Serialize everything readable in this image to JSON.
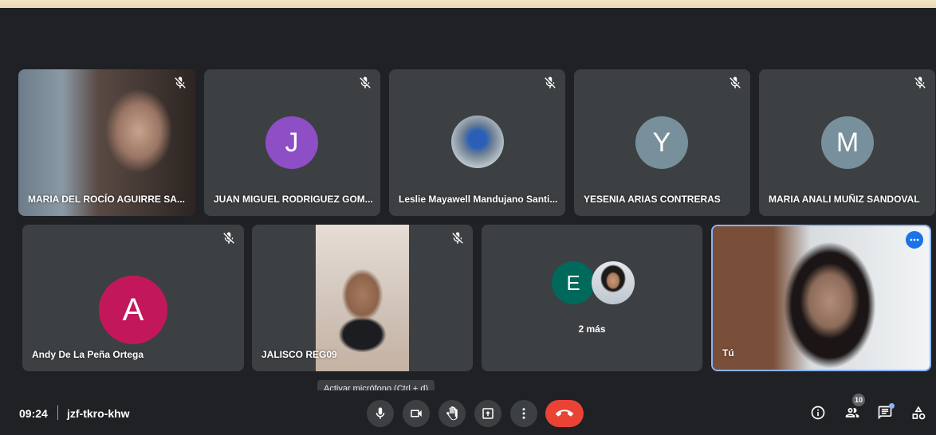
{
  "participants": [
    {
      "name": "MARIA DEL ROCÍO AGUIRRE SA...",
      "type": "video",
      "muted": true
    },
    {
      "name": "JUAN MIGUEL RODRIGUEZ GOM...",
      "type": "avatar",
      "initial": "J",
      "color": "#8e4ec6",
      "muted": true
    },
    {
      "name": "Leslie Mayawell Mandujano Santi...",
      "type": "photo",
      "muted": true
    },
    {
      "name": "YESENIA ARIAS CONTRERAS",
      "type": "avatar",
      "initial": "Y",
      "color": "#78909c",
      "muted": true
    },
    {
      "name": "MARIA ANALI MUÑIZ SANDOVAL",
      "type": "avatar",
      "initial": "M",
      "color": "#78909c",
      "muted": true
    },
    {
      "name": "Andy De La Peña Ortega",
      "type": "avatar",
      "initial": "A",
      "color": "#c2185b",
      "muted": true
    },
    {
      "name": "JALISCO REG09",
      "type": "video",
      "muted": true
    },
    {
      "name": "",
      "type": "group",
      "initial": "E",
      "color": "#00695c",
      "extra": "2 más"
    },
    {
      "name": "Tú",
      "type": "self",
      "muted": false
    }
  ],
  "bar": {
    "time": "09:24",
    "meeting_code": "jzf-tkro-khw",
    "tooltip": "Activar micrófono (Ctrl + d)",
    "participant_count": "10"
  },
  "icons": {
    "mic": "mic-off-icon",
    "camera": "camera-icon",
    "hand": "raise-hand-icon",
    "present": "present-screen-icon",
    "more": "more-options-icon",
    "end": "end-call-icon",
    "info": "info-icon",
    "people": "people-icon",
    "chat": "chat-icon",
    "activities": "activities-icon"
  },
  "colors": {
    "end_call": "#ea4335",
    "self_border": "#8ab4f8",
    "accent": "#1a73e8"
  }
}
